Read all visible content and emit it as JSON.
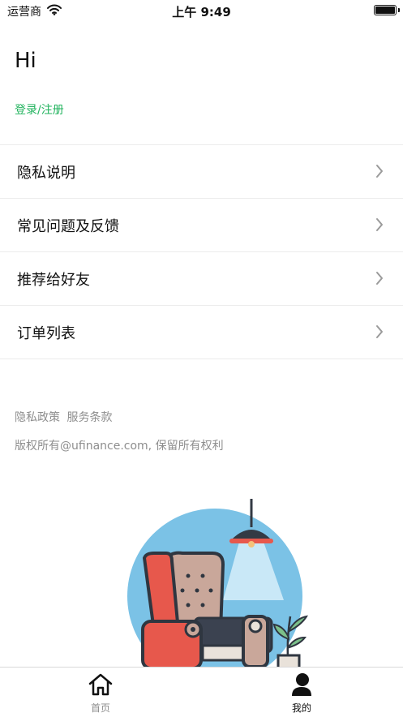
{
  "status_bar": {
    "carrier": "运营商",
    "time": "上午 9:49"
  },
  "header": {
    "greeting": "Hi",
    "login_link": "登录/注册"
  },
  "menu": {
    "items": [
      {
        "label": "隐私说明"
      },
      {
        "label": "常见问题及反馈"
      },
      {
        "label": "推荐给好友"
      },
      {
        "label": "订单列表"
      }
    ]
  },
  "footer": {
    "privacy_policy": "隐私政策",
    "terms_of_service": "服务条款",
    "copyright": "版权所有@ufinance.com, 保留所有权利"
  },
  "tab_bar": {
    "tabs": [
      {
        "label": "首页",
        "icon": "home-icon",
        "active": false
      },
      {
        "label": "我的",
        "icon": "person-icon",
        "active": true
      }
    ]
  },
  "colors": {
    "accent_green": "#22b35e",
    "muted_text": "#8e8e8e"
  }
}
